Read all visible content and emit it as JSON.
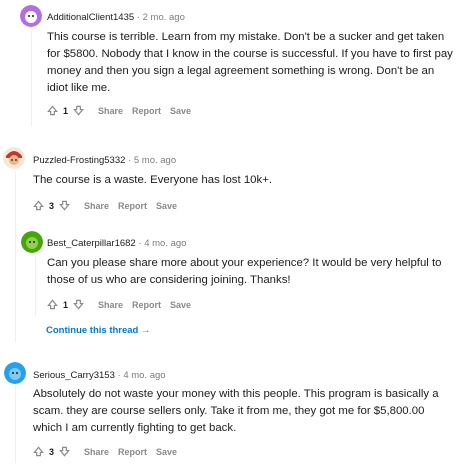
{
  "comments": [
    {
      "user": "AdditionalClient1435",
      "age": "2 mo. ago",
      "text": "This course is terrible. Learn from my mistake. Don't be a sucker and get taken for $5800. Nobody that I know in the course is successful. If you have to first pay money and then you sign a legal agreement something is wrong. Don't be an idiot like me.",
      "votes": "1",
      "avatar_color": "#b56ee0"
    },
    {
      "user": "Puzzled-Frosting5332",
      "age": "5 mo. ago",
      "text": "The course is a waste. Everyone has lost 10k+.",
      "votes": "3",
      "avatar_color": "#c0392b"
    },
    {
      "user": "Best_Caterpillar1682",
      "age": "4 mo. ago",
      "text": "Can you please share more about your experience? It would be very helpful to those of us who are considering joining. Thanks!",
      "votes": "1",
      "avatar_color": "#46a508"
    },
    {
      "user": "Serious_Carry3153",
      "age": "4 mo. ago",
      "text": "Absolutely do not waste your money with this people. This program is basically a scam. they are course sellers only. Take it from me, they got me for $5,800.00 which I am currently fighting to get back.",
      "votes": "3",
      "avatar_color": "#24a0ed"
    }
  ],
  "actions": {
    "share": "Share",
    "report": "Report",
    "save": "Save"
  },
  "separator": "·",
  "continue_thread": "Continue this thread →"
}
